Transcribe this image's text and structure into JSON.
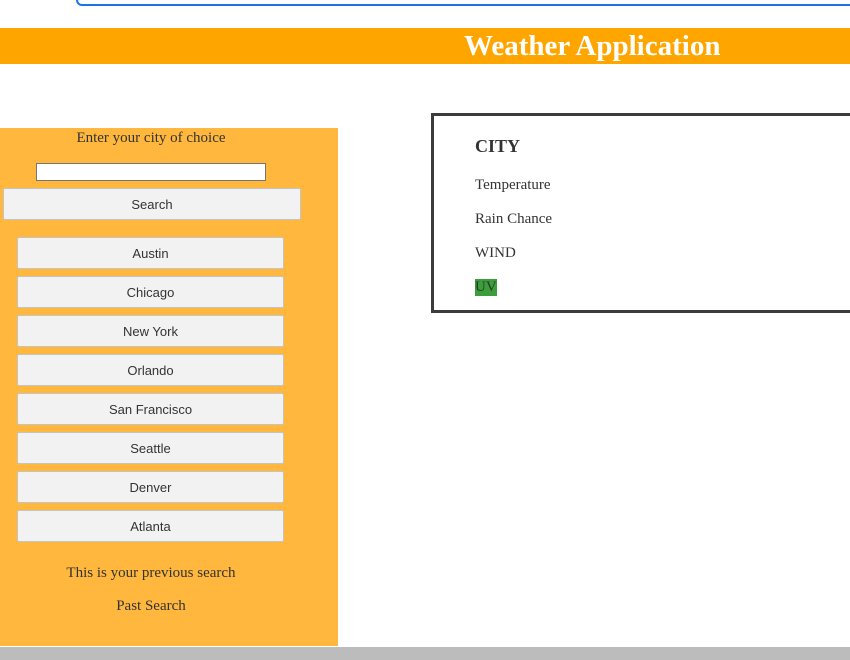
{
  "header": {
    "title": "Weather Application",
    "background_color": "#ffa500"
  },
  "sidebar": {
    "background_color": "#ffb83d",
    "prompt_label": "Enter your city of choice",
    "city_input_value": "",
    "search_label": "Search",
    "cities": [
      "Austin",
      "Chicago",
      "New York",
      "Orlando",
      "San Francisco",
      "Seattle",
      "Denver",
      "Atlanta"
    ],
    "previous_search_label": "This is your previous search",
    "past_search_text": "Past Search"
  },
  "weather_card": {
    "city": "CITY",
    "temperature_label": "Temperature",
    "rain_chance_label": "Rain Chance",
    "wind_label": "WIND",
    "uv_label": "UV",
    "uv_color": "#3a9e3a"
  }
}
